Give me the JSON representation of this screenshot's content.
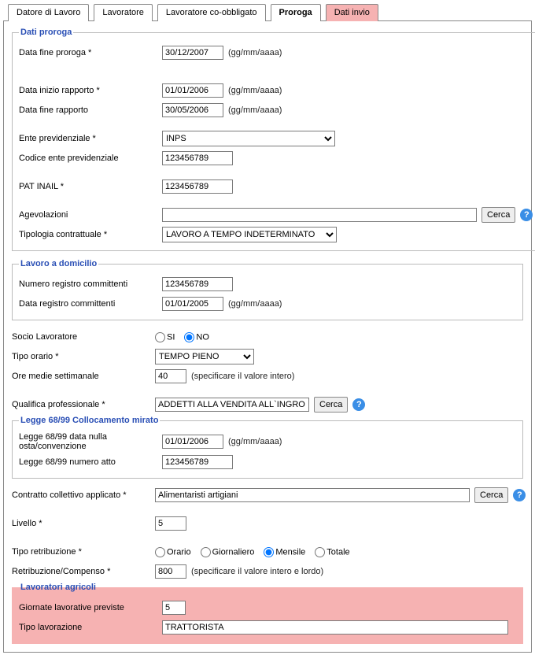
{
  "tabs": {
    "datore": "Datore di Lavoro",
    "lavoratore": "Lavoratore",
    "coobb": "Lavoratore co-obbligato",
    "proroga": "Proroga",
    "invio": "Dati invio"
  },
  "sections": {
    "dati_proroga": "Dati proroga",
    "lavoro_domicilio": "Lavoro a domicilio",
    "legge68": "Legge 68/99 Collocamento mirato",
    "agricoli": "Lavoratori agricoli"
  },
  "labels": {
    "data_fine_proroga": "Data fine proroga *",
    "data_inizio_rapporto": "Data inizio rapporto *",
    "data_fine_rapporto": "Data fine rapporto",
    "ente_previdenziale": "Ente previdenziale *",
    "codice_ente": "Codice ente previdenziale",
    "pat_inail": "PAT INAIL *",
    "agevolazioni": "Agevolazioni",
    "tipologia_contrattuale": "Tipologia contrattuale *",
    "num_registro": "Numero registro committenti",
    "data_registro": "Data registro committenti",
    "socio_lavoratore": "Socio Lavoratore",
    "tipo_orario": "Tipo orario *",
    "ore_medie": "Ore medie settimanale",
    "qualifica": "Qualifica professionale *",
    "legge68_data": "Legge 68/99 data nulla osta/convenzione",
    "legge68_numero": "Legge 68/99 numero atto",
    "contratto_collettivo": "Contratto collettivo applicato *",
    "livello": "Livello *",
    "tipo_retribuzione": "Tipo retribuzione *",
    "retribuzione_compenso": "Retribuzione/Compenso *",
    "giornate_prev": "Giornate lavorative previste",
    "tipo_lavorazione": "Tipo lavorazione"
  },
  "hints": {
    "date_fmt": "(gg/mm/aaaa)",
    "int_spec": "(specificare il valore intero)",
    "int_lordo": "(specificare il valore intero e lordo)"
  },
  "values": {
    "data_fine_proroga": "30/12/2007",
    "data_inizio_rapporto": "01/01/2006",
    "data_fine_rapporto": "30/05/2006",
    "ente_previdenziale": "INPS",
    "codice_ente": "123456789",
    "pat_inail": "123456789",
    "agevolazioni": "",
    "tipologia_contrattuale": "LAVORO A TEMPO INDETERMINATO",
    "num_registro": "123456789",
    "data_registro": "01/01/2005",
    "socio_lavoratore": "NO",
    "tipo_orario": "TEMPO PIENO",
    "ore_medie": "40",
    "qualifica": "ADDETTI ALLA VENDITA ALL`INGRO",
    "legge68_data": "01/01/2006",
    "legge68_numero": "123456789",
    "contratto_collettivo": "Alimentaristi artigiani",
    "livello": "5",
    "tipo_retribuzione": "Mensile",
    "retribuzione_compenso": "800",
    "giornate_prev": "5",
    "tipo_lavorazione": "TRATTORISTA"
  },
  "options": {
    "socio": {
      "si": "SI",
      "no": "NO"
    },
    "retribuzione": {
      "orario": "Orario",
      "giornaliero": "Giornaliero",
      "mensile": "Mensile",
      "totale": "Totale"
    }
  },
  "text": {
    "cerca_btn": "Cerca",
    "help": "?"
  }
}
